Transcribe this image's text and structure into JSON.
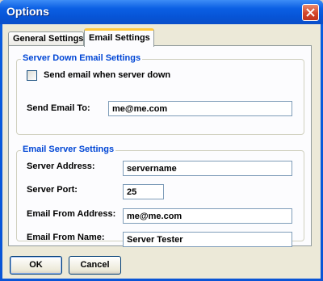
{
  "window": {
    "title": "Options"
  },
  "tabs": [
    {
      "label": "General Settings"
    },
    {
      "label": "Email Settings"
    }
  ],
  "server_down": {
    "group_label": "Server Down Email Settings",
    "checkbox_label": "Send email when server down",
    "checkbox_checked": false,
    "send_to_label": "Send Email To:",
    "send_to_value": "me@me.com"
  },
  "email_server": {
    "group_label": "Email Server Settings",
    "address_label": "Server Address:",
    "address_value": "servername",
    "port_label": "Server Port:",
    "port_value": "25",
    "from_address_label": "Email From Address:",
    "from_address_value": "me@me.com",
    "from_name_label": "Email From Name:",
    "from_name_value": "Server Tester"
  },
  "buttons": {
    "ok_label": "OK",
    "cancel_label": "Cancel"
  },
  "colors": {
    "titlebar": "#0754d6",
    "group_label": "#0046d5",
    "tab_highlight": "#ffc83c"
  }
}
